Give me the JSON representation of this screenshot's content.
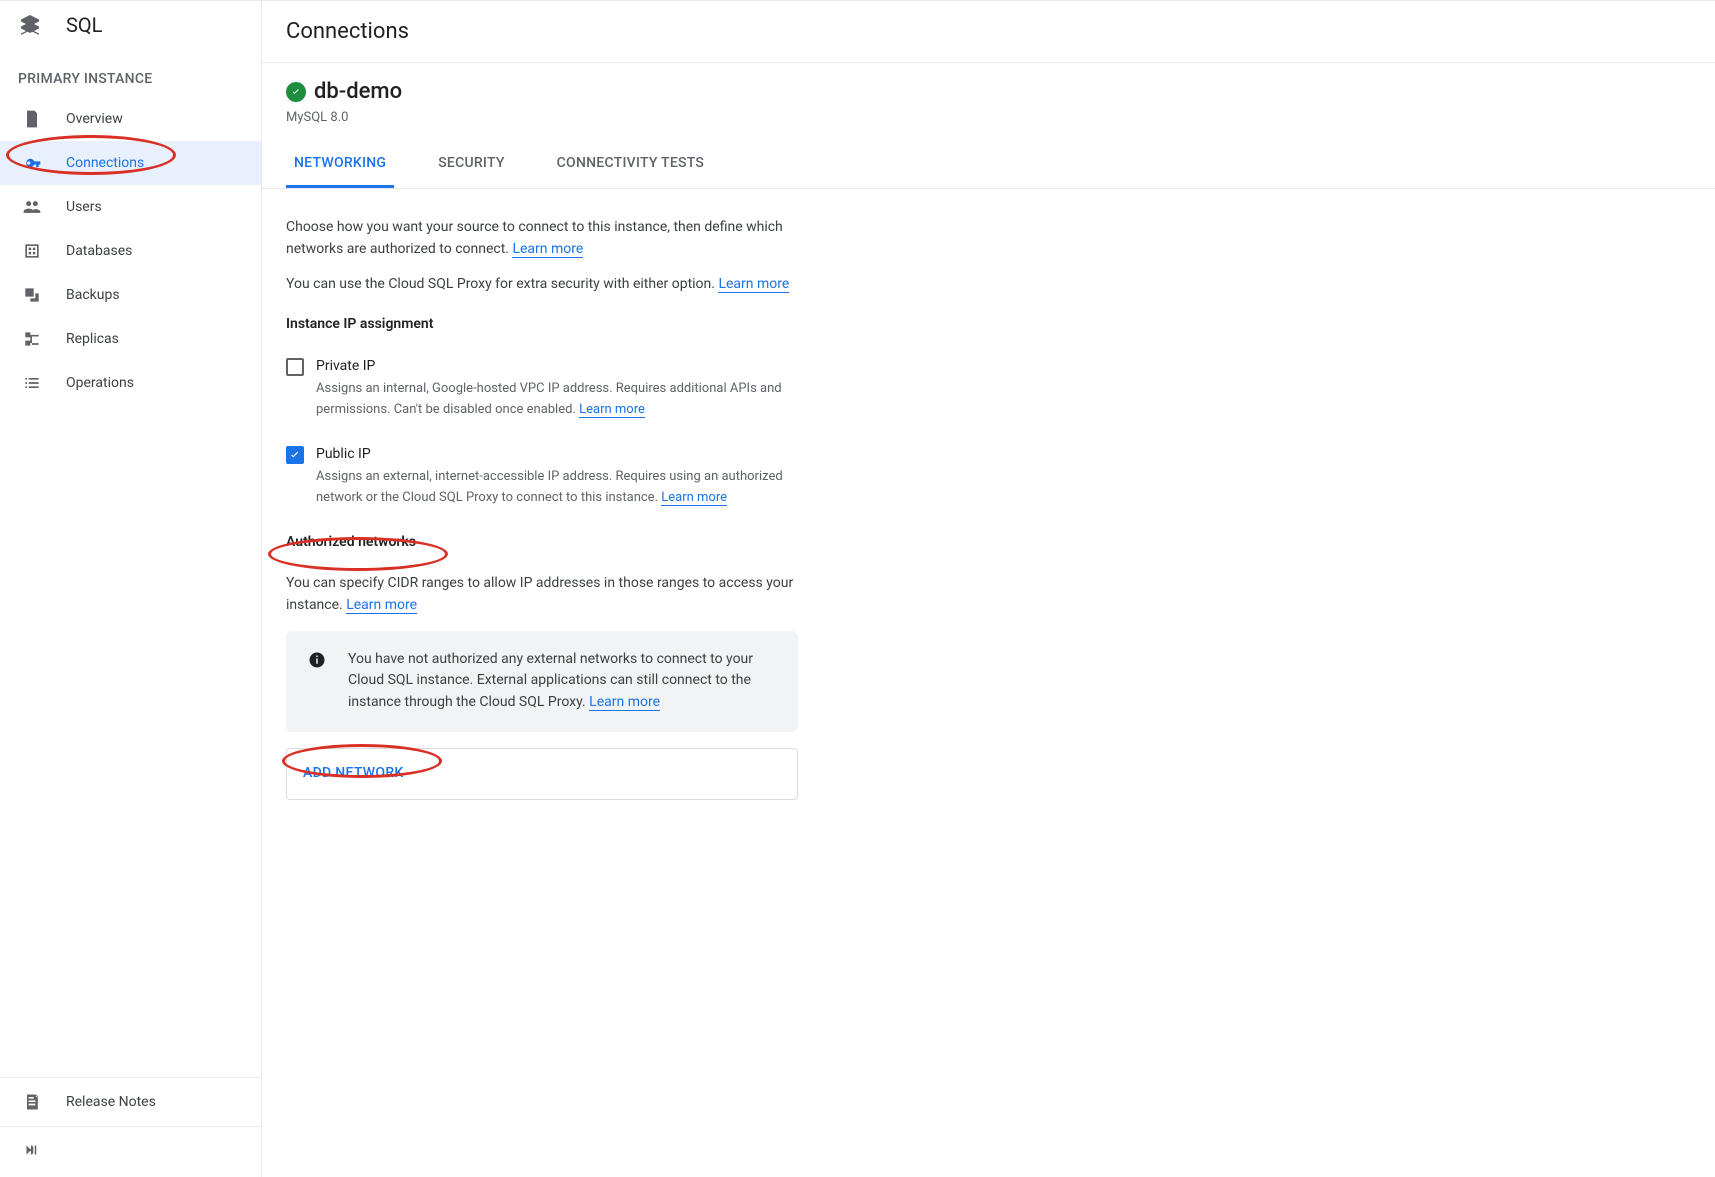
{
  "product": {
    "title": "SQL"
  },
  "sidebar": {
    "section_label": "PRIMARY INSTANCE",
    "items": [
      {
        "label": "Overview"
      },
      {
        "label": "Connections"
      },
      {
        "label": "Users"
      },
      {
        "label": "Databases"
      },
      {
        "label": "Backups"
      },
      {
        "label": "Replicas"
      },
      {
        "label": "Operations"
      }
    ],
    "footer": {
      "release_notes": "Release Notes"
    }
  },
  "page": {
    "title": "Connections",
    "instance_name": "db-demo",
    "instance_subtitle": "MySQL 8.0"
  },
  "tabs": [
    {
      "label": "NETWORKING"
    },
    {
      "label": "SECURITY"
    },
    {
      "label": "CONNECTIVITY TESTS"
    }
  ],
  "networking": {
    "intro1": "Choose how you want your source to connect to this instance, then define which networks are authorized to connect. ",
    "learn_more": "Learn more",
    "intro2": "You can use the Cloud SQL Proxy for extra security with either option. ",
    "ip_assignment_title": "Instance IP assignment",
    "private_ip": {
      "label": "Private IP",
      "desc": "Assigns an internal, Google-hosted VPC IP address. Requires additional APIs and permissions. Can't be disabled once enabled. "
    },
    "public_ip": {
      "label": "Public IP",
      "desc": "Assigns an external, internet-accessible IP address. Requires using an authorized network or the Cloud SQL Proxy to connect to this instance. "
    },
    "authorized_title": "Authorized networks",
    "authorized_desc": "You can specify CIDR ranges to allow IP addresses in those ranges to access your instance. ",
    "info_box": "You have not authorized any external networks to connect to your Cloud SQL instance. External applications can still connect to the instance through the Cloud SQL Proxy. ",
    "add_network": "ADD NETWORK"
  }
}
